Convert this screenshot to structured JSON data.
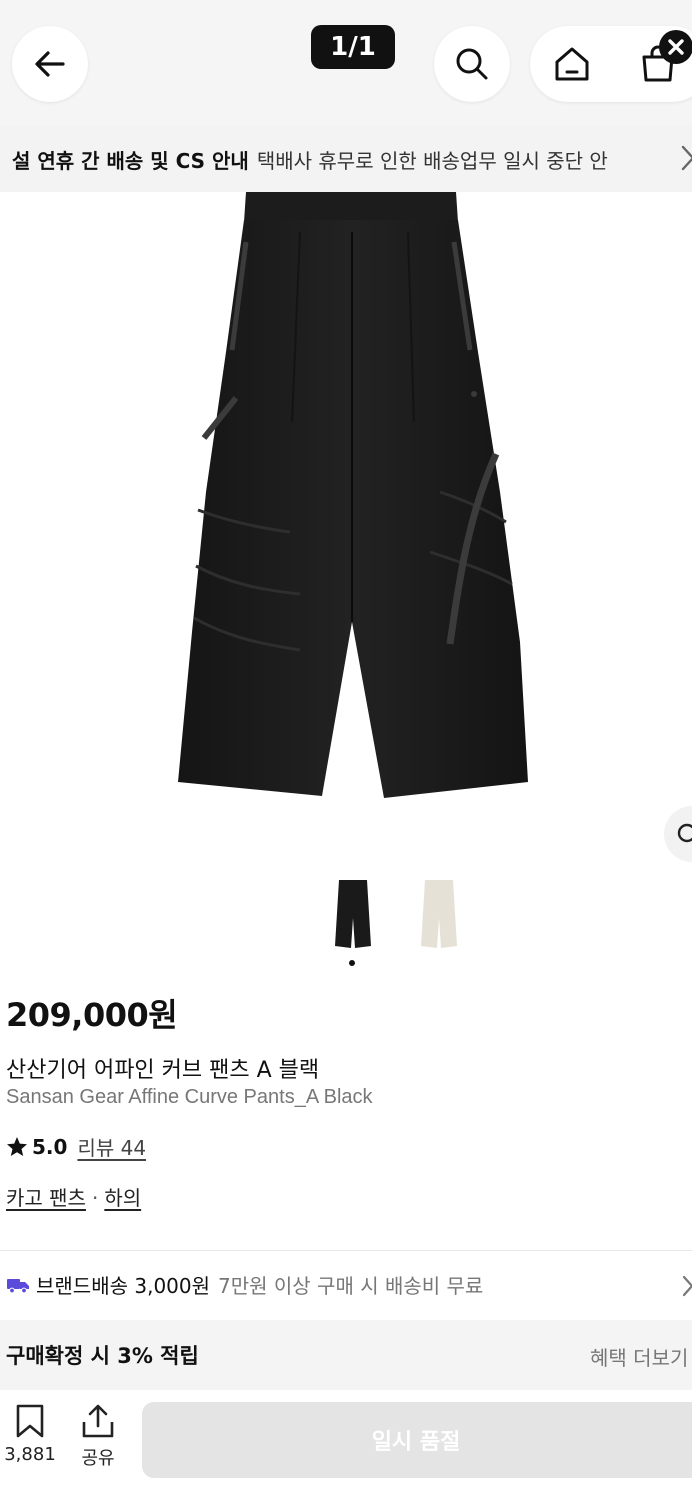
{
  "top": {
    "counter": "1/1",
    "back_icon": "arrow-left-icon",
    "search_icon": "search-icon",
    "home_icon": "home-icon",
    "bag_icon": "shopping-bag-icon"
  },
  "notice": {
    "title": "설 연휴 간 배송 및 CS 안내",
    "text": "택배사 휴무로 인한 배송업무 일시 중단 안"
  },
  "product": {
    "price": "209,000원",
    "name_ko": "산산기어 어파인 커브 팬츠 A 블랙",
    "name_en": "Sansan Gear Affine Curve Pants_A Black",
    "rating": "5.0",
    "review": "리뷰 44",
    "category": "카고 팬츠",
    "category_sep": "·",
    "subcategory": "하의",
    "colors": [
      "#1a1a1a",
      "#e6e1d6"
    ]
  },
  "shipping": {
    "label": "브랜드배송 3,000원",
    "free_condition": "7만원 이상 구매 시 배송비 무료"
  },
  "benefit": {
    "label": "구매확정 시 3% 적립",
    "more": "혜택 더보기"
  },
  "bottom": {
    "like_count": "3,881",
    "share_label": "공유",
    "cta": "일시 품절"
  }
}
